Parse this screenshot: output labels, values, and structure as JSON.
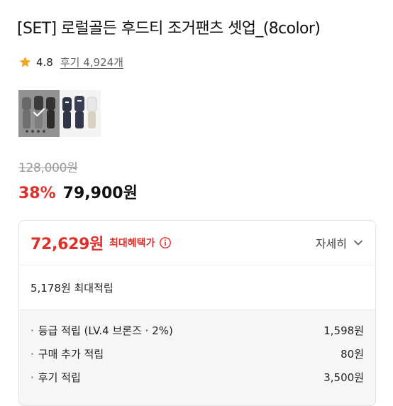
{
  "product": {
    "title": "[SET] 로럴골든 후드티 조거팬츠 셋업_(8color)",
    "rating": "4.8",
    "reviews": "후기 4,924개"
  },
  "price": {
    "original": "128,000원",
    "discount": "38%",
    "sale": "79,900원"
  },
  "benefit": {
    "max_price": "72,629원",
    "max_label": "최대혜택가",
    "detail_toggle": "자세히",
    "points_total": "5,178원 최대적립",
    "points": [
      {
        "label": "등급 적립 (LV.4 브론즈 · 2%)",
        "value": "1,598원"
      },
      {
        "label": "구매 추가 적립",
        "value": "80원"
      },
      {
        "label": "후기 적립",
        "value": "3,500원"
      }
    ]
  },
  "colors": {
    "accent_red": "#e0302b",
    "star": "#f5a623"
  },
  "icons": {
    "star": "star-icon",
    "info": "info-icon",
    "chevron": "chevron-down-icon",
    "check": "check-icon"
  }
}
